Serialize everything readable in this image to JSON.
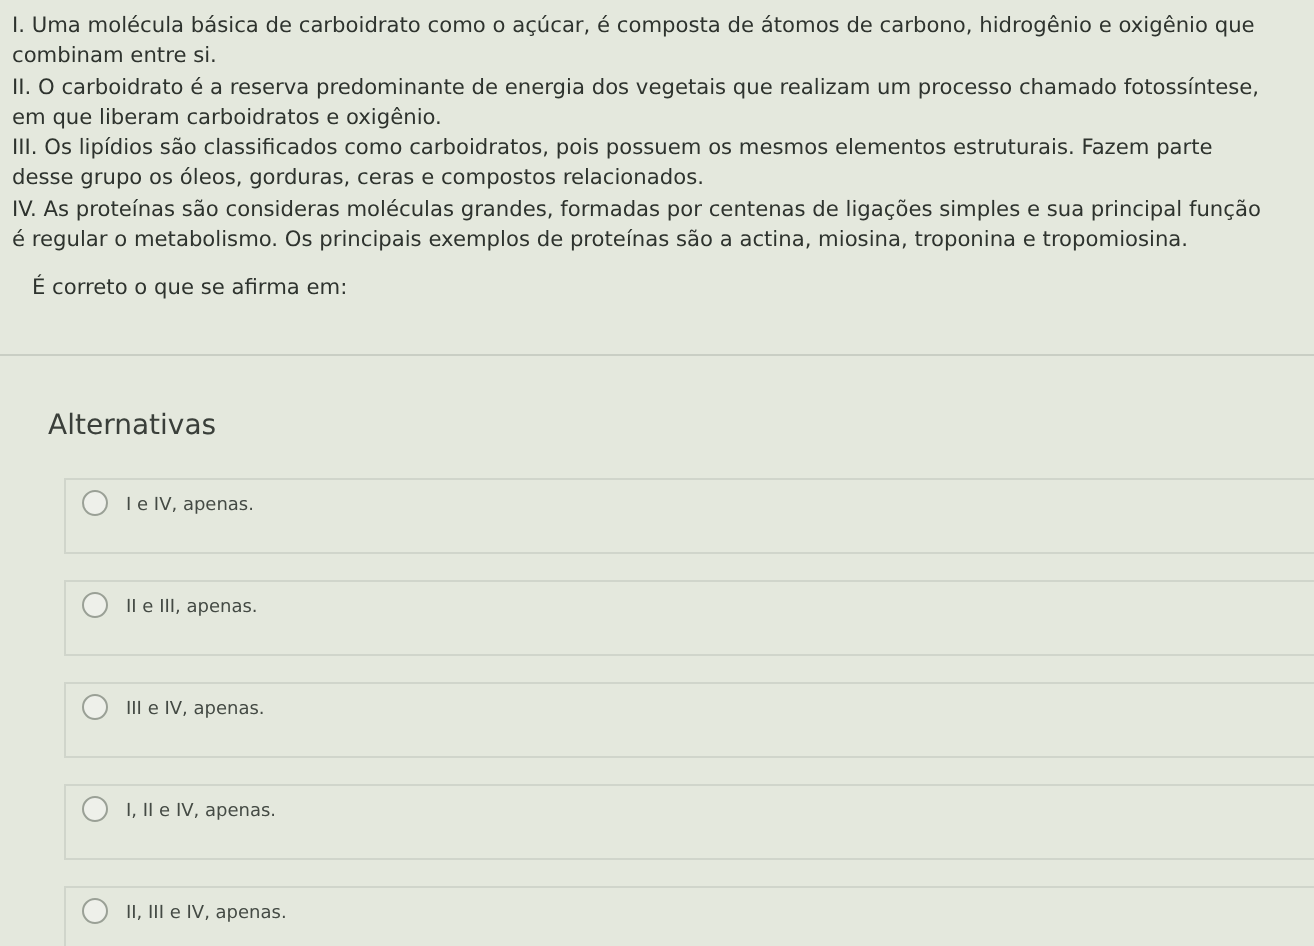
{
  "statements": [
    "I. Uma molécula básica de carboidrato como o açúcar, é composta de átomos de carbono, hidrogênio e oxigênio que combinam entre si.",
    "II. O carboidrato é a reserva predominante de energia dos vegetais que realizam um processo chamado fotossíntese, em que liberam carboidratos e oxigênio.",
    "III. Os lipídios são classificados como carboidratos, pois possuem os mesmos elementos estruturais. Fazem parte desse grupo os óleos, gorduras, ceras e compostos relacionados.",
    "IV. As proteínas são consideras moléculas grandes, formadas por centenas de ligações simples e sua principal função é regular o metabolismo. Os principais exemplos de proteínas são a actina, miosina, troponina e tropomiosina."
  ],
  "question": "É correto o que se afirma em:",
  "alternatives": {
    "heading": "Alternativas",
    "options": [
      {
        "label": "I e IV, apenas.",
        "selected": false
      },
      {
        "label": "II e III, apenas.",
        "selected": false
      },
      {
        "label": "III e IV, apenas.",
        "selected": false
      },
      {
        "label": "I, II e IV, apenas.",
        "selected": false
      },
      {
        "label": "II, III e IV, apenas.",
        "selected": false
      }
    ]
  }
}
